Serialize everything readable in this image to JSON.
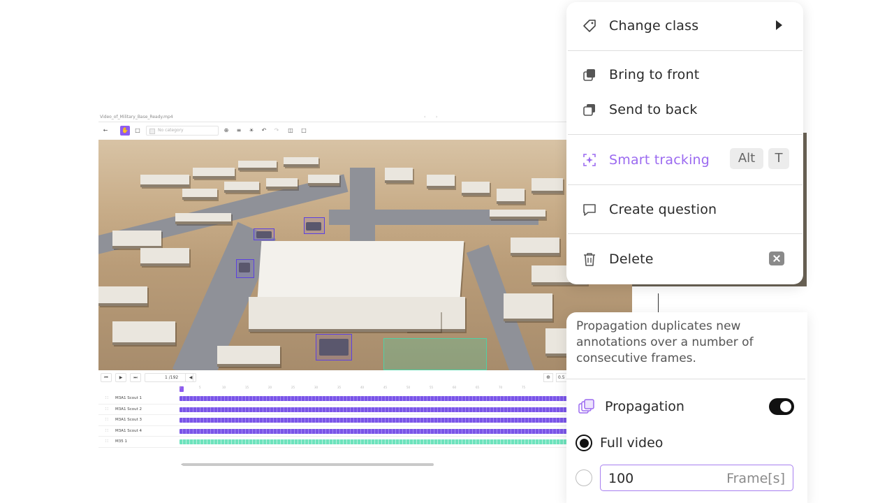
{
  "editor": {
    "file_name": "Video_of_Military_Base_Ready.mp4",
    "category_placeholder": "No category",
    "frame_current": "1",
    "frame_total": "/192",
    "zoom_value": "0.5"
  },
  "timeline": {
    "ticks": [
      "1",
      "5",
      "10",
      "15",
      "20",
      "25",
      "30",
      "35",
      "40",
      "45",
      "50",
      "55",
      "60",
      "65",
      "70",
      "75"
    ],
    "tracks": [
      {
        "name": "M3A1 Scout 1",
        "color": "#7a55e8"
      },
      {
        "name": "M3A1 Scout 2",
        "color": "#7a55e8"
      },
      {
        "name": "M3A1 Scout 3",
        "color": "#7a55e8"
      },
      {
        "name": "M3A1 Scout 4",
        "color": "#7a55e8"
      },
      {
        "name": "M35 1",
        "color": "#6ee3bd"
      }
    ]
  },
  "menu": {
    "change_class": "Change class",
    "bring_to_front": "Bring to front",
    "send_to_back": "Send to back",
    "smart_tracking": "Smart tracking",
    "smart_tracking_keys": [
      "Alt",
      "T"
    ],
    "create_question": "Create question",
    "delete": "Delete"
  },
  "propagation": {
    "description": "Propagation duplicates new annotations over a number of consecutive frames.",
    "label": "Propagation",
    "enabled": true,
    "option_full_video": "Full video",
    "frames_value": "100",
    "frames_unit": "Frame[s]"
  },
  "colors": {
    "accent": "#9b6af0",
    "annotation_box": "#5b40e0",
    "annotation_box_alt": "#4fd1a5"
  }
}
